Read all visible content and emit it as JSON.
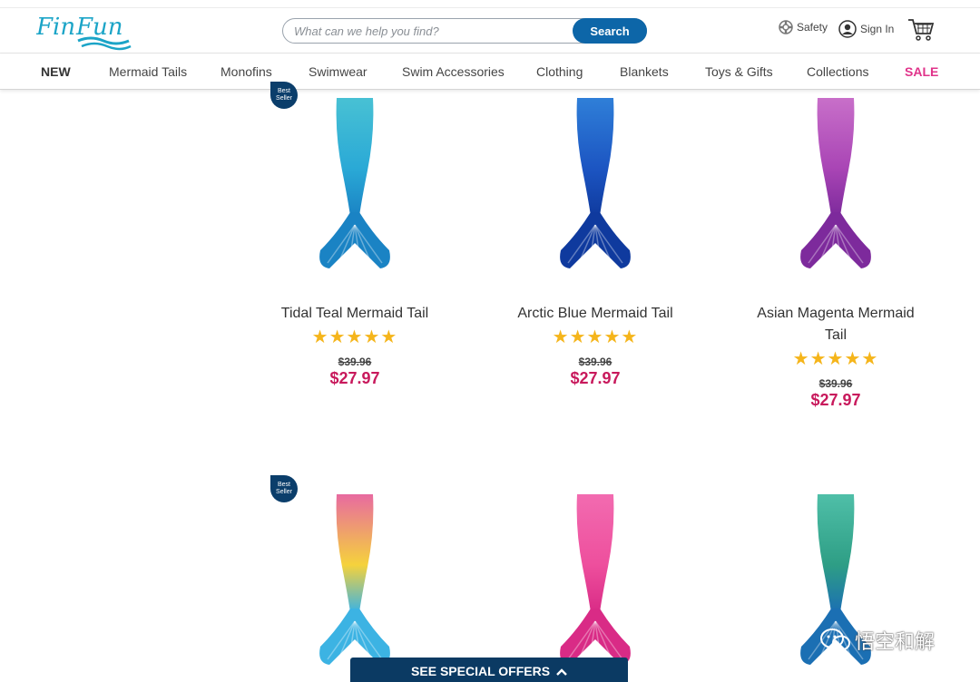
{
  "header": {
    "search_placeholder": "What can we help you find?",
    "search_button": "Search",
    "safety_label": "Safety",
    "signin_label": "Sign In"
  },
  "nav": {
    "items": [
      "NEW",
      "Mermaid Tails",
      "Monofins",
      "Swimwear",
      "Swim Accessories",
      "Clothing",
      "Blankets",
      "Toys & Gifts",
      "Collections",
      "SALE"
    ]
  },
  "products": [
    {
      "name": "Tidal Teal Mermaid Tail",
      "rating": 5,
      "stars": "★★★★★",
      "old_price": "$39.96",
      "price": "$27.97",
      "badge": "Best Seller",
      "colors": [
        "#48c1d4",
        "#2aa9d6",
        "#1a83c4"
      ]
    },
    {
      "name": "Arctic Blue Mermaid Tail",
      "rating": 5,
      "stars": "★★★★★",
      "old_price": "$39.96",
      "price": "$27.97",
      "colors": [
        "#2f7fd8",
        "#1c55c2",
        "#0f3a9e"
      ]
    },
    {
      "name": "Asian Magenta Mermaid Tail",
      "rating": 5,
      "stars": "★★★★★",
      "old_price": "$39.96",
      "price": "$27.97",
      "colors": [
        "#c86fc9",
        "#a945b5",
        "#7d2a9c"
      ]
    },
    {
      "badge": "Best Seller",
      "colors": [
        "#e86aa0",
        "#f5d23c",
        "#3cb3e3"
      ]
    },
    {
      "colors": [
        "#f26bb0",
        "#ee4f9d",
        "#d92b86"
      ]
    },
    {
      "colors": [
        "#4fbfa8",
        "#2e9e85",
        "#1b6fb3"
      ]
    }
  ],
  "footer": {
    "offers_label": "SEE SPECIAL OFFERS",
    "watermark": "悟空和解"
  },
  "colors": {
    "brand_blue": "#0d66a8",
    "sale_pink": "#e0338a",
    "price_red": "#c8195c",
    "star": "#f5b51b",
    "offers_bg": "#0b3a63"
  }
}
